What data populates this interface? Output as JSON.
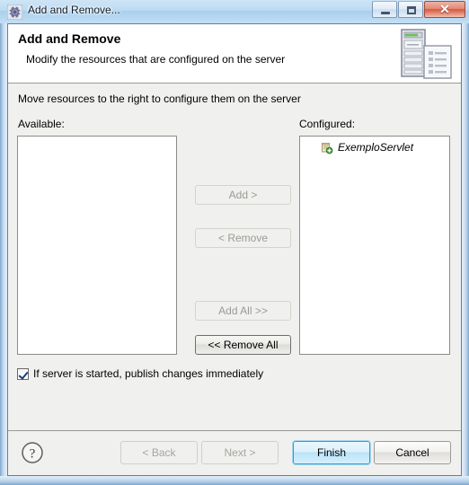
{
  "window": {
    "title": "Add and Remove...",
    "title_icon": "gear-icon",
    "minimize_label": "Minimize",
    "maximize_label": "Maximize",
    "close_label": "Close",
    "close_glyph": "✕"
  },
  "banner": {
    "title": "Add and Remove",
    "description": "Modify the resources that are configured on the server",
    "icon": "server-and-document-icon"
  },
  "content": {
    "instruction": "Move resources to the right to configure them on the server",
    "available_label": "Available:",
    "configured_label": "Configured:",
    "available_items": [],
    "configured_items": [
      {
        "label": "ExemploServlet",
        "icon": "servlet-module-icon"
      }
    ],
    "transfer_buttons": [
      {
        "label": "Add >",
        "enabled": false
      },
      {
        "label": "< Remove",
        "enabled": false
      },
      {
        "label": "Add All >>",
        "enabled": false
      },
      {
        "label": "<< Remove All",
        "enabled": true
      }
    ],
    "publish_checkbox": {
      "label": "If server is started, publish changes immediately",
      "checked": true
    }
  },
  "footer": {
    "help_icon": "help-question-icon",
    "buttons": [
      {
        "label": "< Back",
        "state": "disabled"
      },
      {
        "label": "Next >",
        "state": "disabled"
      },
      {
        "label": "Finish",
        "state": "default"
      },
      {
        "label": "Cancel",
        "state": "normal"
      }
    ]
  },
  "colors": {
    "accent": "#3c99c7",
    "dialog_bg": "#f0f0ee",
    "banner_bg": "#ffffff",
    "frame_border": "#5b7fa6",
    "close_button": "#cf5a42"
  }
}
